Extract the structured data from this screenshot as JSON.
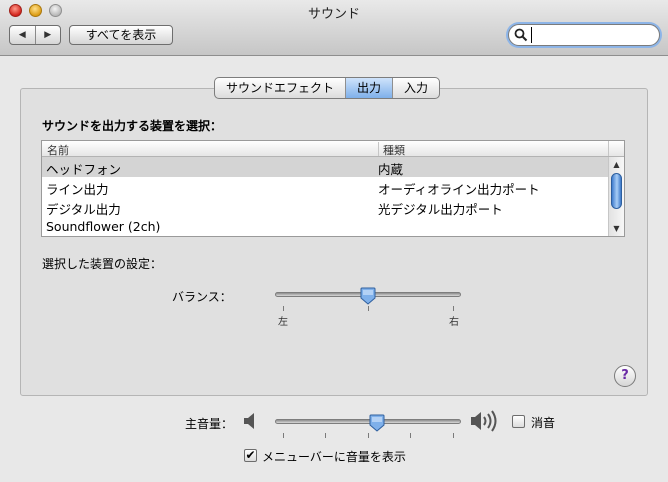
{
  "window": {
    "title": "サウンド"
  },
  "toolbar": {
    "back_glyph": "◀",
    "forward_glyph": "▶",
    "show_all_label": "すべてを表示",
    "search": {
      "value": "",
      "placeholder": ""
    }
  },
  "tabs": [
    {
      "label": "サウンドエフェクト",
      "active": false
    },
    {
      "label": "出力",
      "active": true
    },
    {
      "label": "入力",
      "active": false
    }
  ],
  "output": {
    "heading": "サウンドを出力する装置を選択：",
    "columns": {
      "name": "名前",
      "kind": "種類"
    },
    "devices": [
      {
        "name": "ヘッドフォン",
        "kind": "内蔵",
        "selected": true
      },
      {
        "name": "ライン出力",
        "kind": "オーディオライン出力ポート",
        "selected": false
      },
      {
        "name": "デジタル出力",
        "kind": "光デジタル出力ポート",
        "selected": false
      },
      {
        "name": "Soundflower (2ch)",
        "kind": "",
        "selected": false
      }
    ],
    "settings_label": "選択した装置の設定：",
    "balance": {
      "label": "バランス：",
      "left_label": "左",
      "right_label": "右",
      "value": 0.5
    },
    "help_glyph": "?"
  },
  "volume": {
    "label": "主音量：",
    "value": 0.55,
    "mute_label": "消音",
    "mute_checked": false,
    "menubar_label": "メニューバーに音量を表示",
    "menubar_checked": true
  },
  "colors": {
    "accent": "#7fb0ea",
    "selected_row": "#d4d4d4",
    "help": "#6a2aa5"
  }
}
